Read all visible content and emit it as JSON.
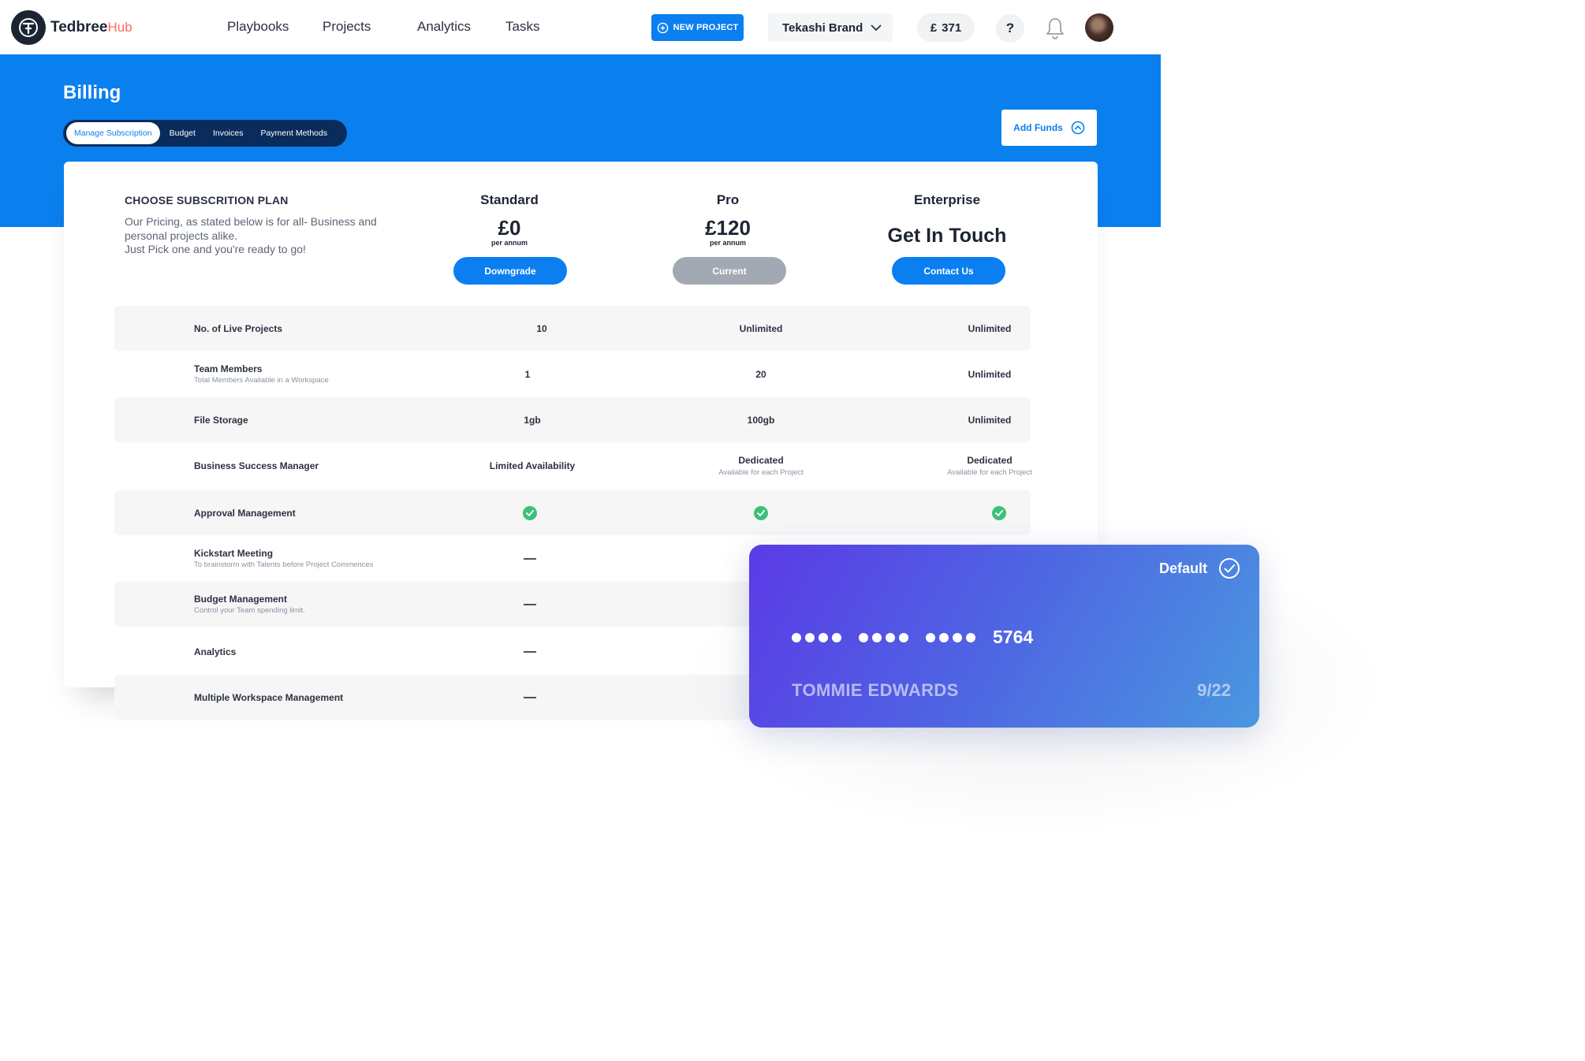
{
  "app": {
    "brand": "Tedbree",
    "brand_suffix": "Hub"
  },
  "nav": {
    "items": [
      "Playbooks",
      "Projects",
      "Analytics",
      "Tasks"
    ]
  },
  "header": {
    "new_project_label": "NEW PROJECT",
    "brand_selector": "Tekashi Brand",
    "currency_symbol": "£",
    "balance": "371",
    "help_label": "?"
  },
  "page": {
    "title": "Billing"
  },
  "tabs": [
    {
      "label": "Manage Subscription",
      "active": true
    },
    {
      "label": "Budget",
      "active": false
    },
    {
      "label": "Invoices",
      "active": false
    },
    {
      "label": "Payment Methods",
      "active": false
    }
  ],
  "add_funds_label": "Add Funds",
  "plans_intro": {
    "title": "CHOOSE SUBSCRITION PLAN",
    "line1": "Our Pricing, as stated below is for all- Business and",
    "line2": "personal projects alike.",
    "line3": "Just Pick one and you're ready to go!"
  },
  "plans": [
    {
      "name": "Standard",
      "price": "£0",
      "per": "per annum",
      "button": "Downgrade",
      "button_color": "#0b7ff0"
    },
    {
      "name": "Pro",
      "price": "£120",
      "per": "per annum",
      "button": "Current",
      "button_color": "#a3a9b3"
    },
    {
      "name": "Enterprise",
      "headline": "Get In Touch",
      "button": "Contact Us",
      "button_color": "#0b7ff0"
    }
  ],
  "features": [
    {
      "name": "No. of Live Projects",
      "sub": "",
      "standard": "10",
      "pro": "Unlimited",
      "enterprise": "Unlimited"
    },
    {
      "name": "Team Members",
      "sub": "Total Members Available in a Workspace",
      "standard": "1",
      "pro": "20",
      "enterprise": "Unlimited"
    },
    {
      "name": "File Storage",
      "sub": "",
      "standard": "1gb",
      "pro": "100gb",
      "enterprise": "Unlimited"
    },
    {
      "name": "Business Success Manager",
      "sub": "",
      "standard": "Limited Availability",
      "pro": "Dedicated",
      "pro_sub": "Available for each Project",
      "enterprise": "Dedicated",
      "enterprise_sub": "Available for each Project"
    },
    {
      "name": "Approval Management",
      "sub": "",
      "standard": "check",
      "pro": "check",
      "enterprise": "check"
    },
    {
      "name": "Kickstart Meeting",
      "sub": "To brainstorm with Talents before Project Commences",
      "standard": "dash",
      "pro": "check"
    },
    {
      "name": "Budget Management",
      "sub": "Control your Team spending limit.",
      "standard": "dash",
      "pro": "check"
    },
    {
      "name": "Analytics",
      "sub": "",
      "standard": "dash",
      "pro": "check"
    },
    {
      "name": "Multiple Workspace Management",
      "sub": "",
      "standard": "dash",
      "pro": "check"
    }
  ],
  "card": {
    "default_label": "Default",
    "last4": "5764",
    "holder": "TOMMIE EDWARDS",
    "expiry": "9/22"
  },
  "colors": {
    "primary": "#0a7fee",
    "success": "#3fc07a",
    "dark": "#1c2434",
    "accent": "#ff6b5a"
  }
}
